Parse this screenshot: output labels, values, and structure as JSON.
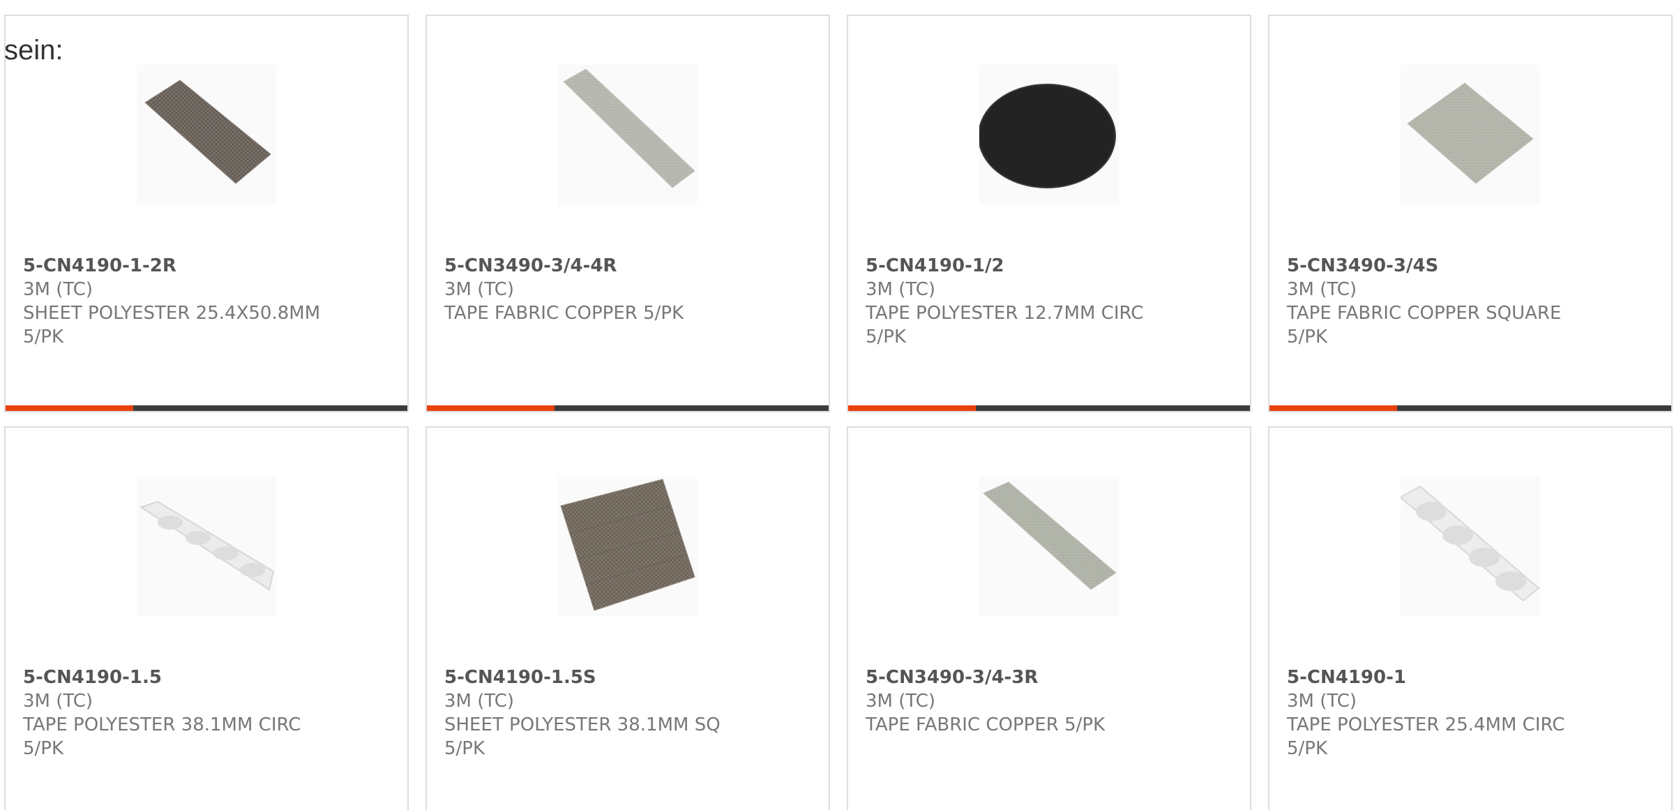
{
  "intro_text": "sein:",
  "colors": {
    "accent": "#e8410c",
    "bar": "#3c3c3c",
    "border": "#dddddd",
    "text": "#777777",
    "part_number": "#555555"
  },
  "products": [
    {
      "part_number": "5-CN4190-1-2R",
      "brand": "3M (TC)",
      "description": "SHEET POLYESTER 25.4X50.8MM",
      "package": "5/PK",
      "image": "dark-mesh-strip"
    },
    {
      "part_number": "5-CN3490-3/4-4R",
      "brand": "3M (TC)",
      "description": "TAPE FABRIC COPPER 5/PK",
      "package": "",
      "image": "grey-fabric-strip"
    },
    {
      "part_number": "5-CN4190-1/2",
      "brand": "3M (TC)",
      "description": "TAPE POLYESTER 12.7MM CIRC",
      "package": "5/PK",
      "image": "black-circle"
    },
    {
      "part_number": "5-CN3490-3/4S",
      "brand": "3M (TC)",
      "description": "TAPE FABRIC COPPER SQUARE",
      "package": "5/PK",
      "image": "grey-fabric-square"
    },
    {
      "part_number": "5-CN4190-1.5",
      "brand": "3M (TC)",
      "description": "TAPE POLYESTER 38.1MM CIRC",
      "package": "5/PK",
      "image": "clear-dots-strip"
    },
    {
      "part_number": "5-CN4190-1.5S",
      "brand": "3M (TC)",
      "description": "SHEET POLYESTER 38.1MM SQ",
      "package": "5/PK",
      "image": "dark-mesh-square"
    },
    {
      "part_number": "5-CN3490-3/4-3R",
      "brand": "3M (TC)",
      "description": "TAPE FABRIC COPPER 5/PK",
      "package": "",
      "image": "grey-fabric-strip"
    },
    {
      "part_number": "5-CN4190-1",
      "brand": "3M (TC)",
      "description": "TAPE POLYESTER 25.4MM CIRC",
      "package": "5/PK",
      "image": "clear-dots-strip"
    }
  ]
}
